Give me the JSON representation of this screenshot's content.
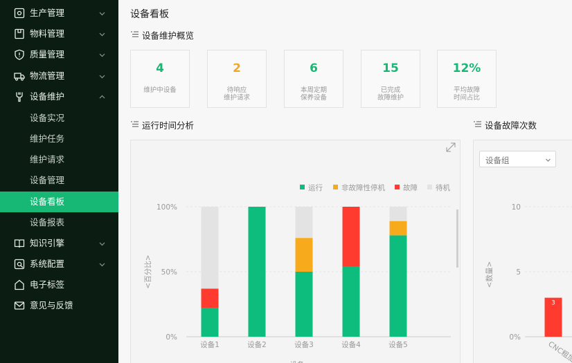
{
  "sidebar": {
    "items": [
      {
        "label": "生产管理",
        "icon": "production-icon",
        "chevron": "down"
      },
      {
        "label": "物料管理",
        "icon": "box-icon",
        "chevron": "down"
      },
      {
        "label": "质量管理",
        "icon": "shield-icon",
        "chevron": "down"
      },
      {
        "label": "物流管理",
        "icon": "truck-icon",
        "chevron": "down"
      },
      {
        "label": "设备维护",
        "icon": "wrench-icon",
        "chevron": "up"
      },
      {
        "label": "设备实况"
      },
      {
        "label": "维护任务"
      },
      {
        "label": "维护请求"
      },
      {
        "label": "设备管理"
      },
      {
        "label": "设备看板",
        "active": true
      },
      {
        "label": "设备报表"
      },
      {
        "label": "知识引擎",
        "icon": "book-icon",
        "chevron": "down"
      },
      {
        "label": "系统配置",
        "icon": "gear-icon",
        "chevron": "down"
      },
      {
        "label": "电子标签",
        "icon": "tag-icon"
      },
      {
        "label": "意见与反馈",
        "icon": "mail-icon"
      }
    ]
  },
  "page": {
    "title": "设备看板"
  },
  "overview": {
    "title": "设备维护概览",
    "cards": [
      {
        "value": "4",
        "label": "维护中设备",
        "color": "#17b876"
      },
      {
        "value": "2",
        "label": "待响应\n维护请求",
        "color": "#f5a623"
      },
      {
        "value": "6",
        "label": "本周定期\n保养设备",
        "color": "#17b876"
      },
      {
        "value": "15",
        "label": "已完成\n故障维护",
        "color": "#17b876"
      },
      {
        "value": "12%",
        "label": "平均故障\n时间占比",
        "color": "#17b876"
      }
    ]
  },
  "runtime": {
    "title": "运行时间分析"
  },
  "faults": {
    "title": "设备故障次数",
    "select_value": "设备组"
  },
  "chart_data": [
    {
      "type": "bar",
      "stacked": true,
      "categories": [
        "设备1",
        "设备2",
        "设备3",
        "设备4",
        "设备5"
      ],
      "series": [
        {
          "name": "运行",
          "color": "#0dbd7d",
          "values": [
            22,
            100,
            50,
            54,
            78
          ]
        },
        {
          "name": "非故障性停机",
          "color": "#f7aa1c",
          "values": [
            0,
            0,
            26,
            0,
            11
          ]
        },
        {
          "name": "故障",
          "color": "#ff3b30",
          "values": [
            15,
            0,
            0,
            46,
            0
          ]
        },
        {
          "name": "待机",
          "color": "#e3e3e3",
          "values": [
            63,
            0,
            24,
            0,
            11
          ]
        }
      ],
      "yticks": [
        "0%",
        "50%",
        "100%"
      ],
      "ylim": [
        0,
        100
      ],
      "ylabel": "<百分比>",
      "xlabel": "设备",
      "legend": "top-right"
    },
    {
      "type": "bar",
      "categories": [
        "CNC粗加"
      ],
      "values": [
        3
      ],
      "data_labels": [
        "3"
      ],
      "color": "#ff3b30",
      "yticks": [
        "0%",
        "5",
        "10"
      ],
      "ylim": [
        0,
        10
      ],
      "ylabel": "<数量>"
    }
  ]
}
